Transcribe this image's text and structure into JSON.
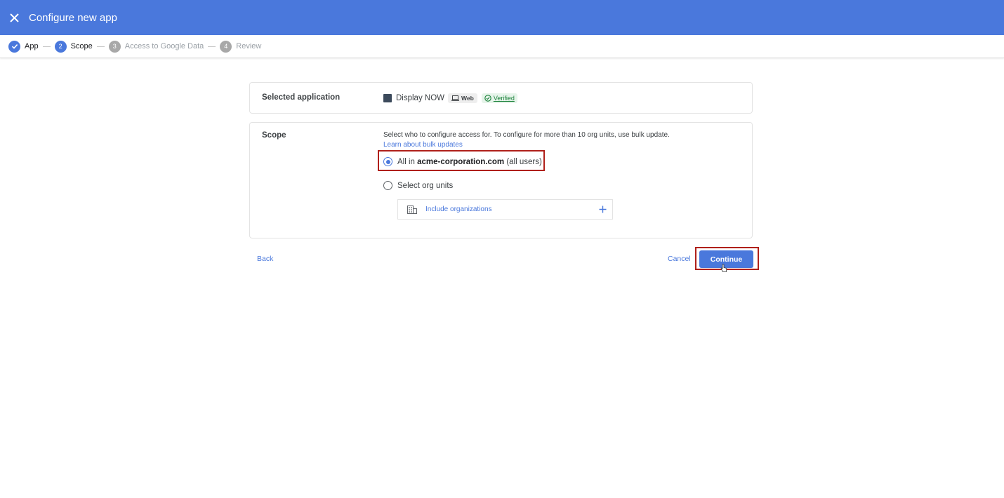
{
  "header": {
    "title": "Configure new app",
    "close_icon": "close-icon"
  },
  "stepper": {
    "steps": [
      {
        "label": "App",
        "state": "complete",
        "icon": "check-icon"
      },
      {
        "label": "Scope",
        "number": "2",
        "state": "active"
      },
      {
        "label": "Access to Google Data",
        "number": "3",
        "state": "inactive"
      },
      {
        "label": "Review",
        "number": "4",
        "state": "inactive"
      }
    ]
  },
  "selected_app": {
    "label": "Selected application",
    "app_name": "Display NOW",
    "platform_chip": "Web",
    "verified_chip": "Verified"
  },
  "scope": {
    "label": "Scope",
    "description": "Select who to configure access for. To configure for more than 10 org units, use bulk update.",
    "learn_link": "Learn about bulk updates",
    "option_all": {
      "prefix": "All in",
      "domain": "acme-corporation.com",
      "suffix": "(all users)",
      "selected": true
    },
    "option_org": {
      "label": "Select org units",
      "selected": false
    },
    "include_label": "Include organizations"
  },
  "footer": {
    "back": "Back",
    "cancel": "Cancel",
    "continue": "Continue"
  },
  "colors": {
    "accent": "#4a78dc",
    "highlight": "#b0201a",
    "verified": "#188038"
  }
}
